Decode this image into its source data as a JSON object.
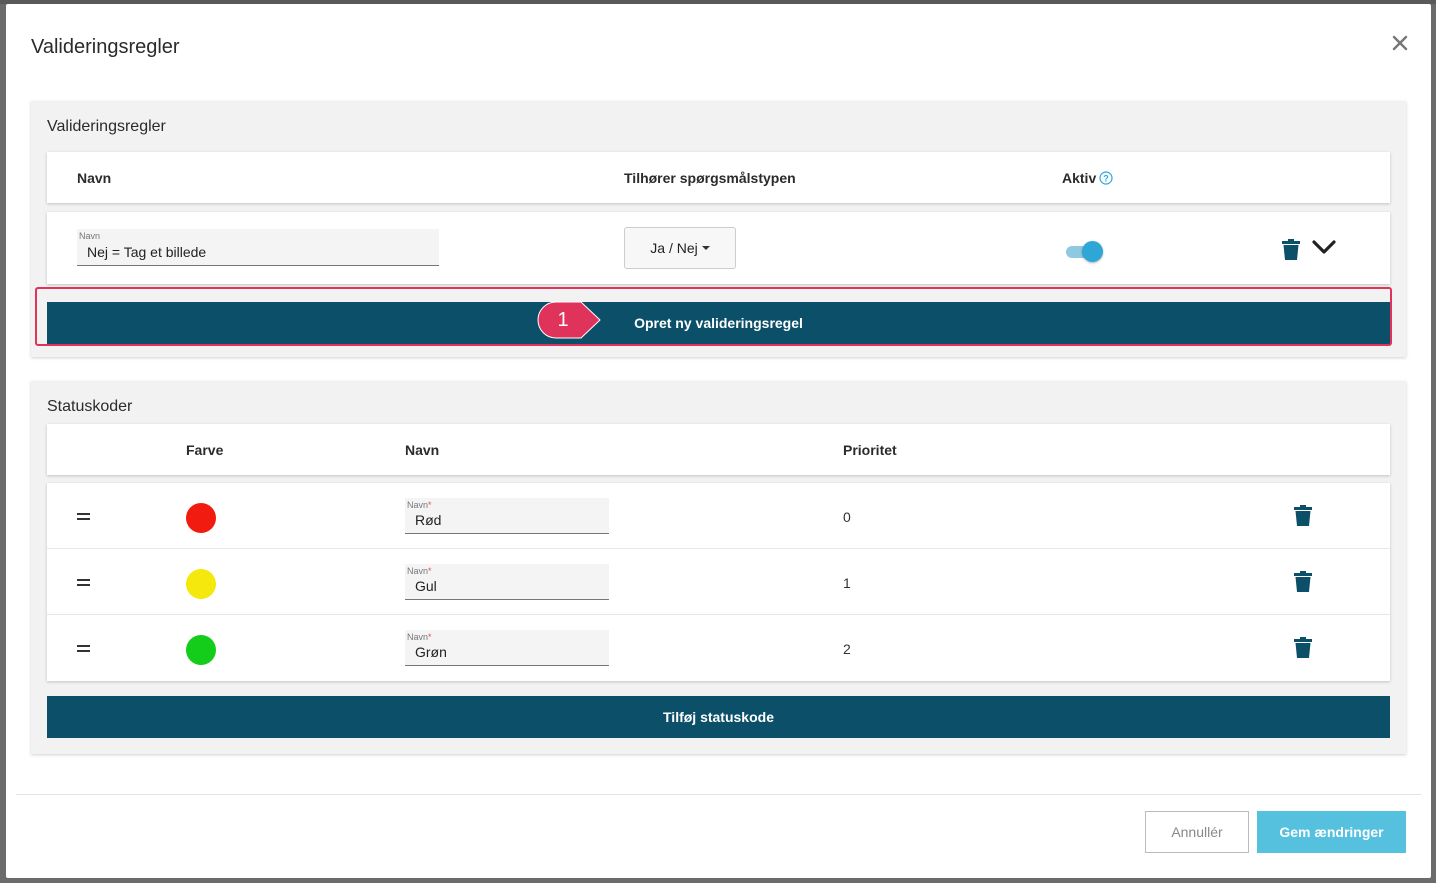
{
  "modal": {
    "title": "Valideringsregler",
    "close_icon": "close-icon"
  },
  "rules_panel": {
    "title": "Valideringsregler",
    "headers": {
      "name": "Navn",
      "question_type": "Tilhører spørgsmålstypen",
      "active": "Aktiv"
    },
    "rule": {
      "name_label": "Navn",
      "name_value": "Nej = Tag et billede",
      "question_type_value": "Ja / Nej",
      "active": true
    },
    "create_button": "Opret ny valideringsregel",
    "callout_number": "1"
  },
  "status_panel": {
    "title": "Statuskoder",
    "headers": {
      "color": "Farve",
      "name": "Navn",
      "priority": "Prioritet"
    },
    "field_label": "Navn",
    "field_required_mark": "*",
    "rows": [
      {
        "color": "#f21b0f",
        "name": "Rød",
        "priority": "0"
      },
      {
        "color": "#f4e80c",
        "name": "Gul",
        "priority": "1"
      },
      {
        "color": "#14cc1a",
        "name": "Grøn",
        "priority": "2"
      }
    ],
    "add_button": "Tilføj statuskode"
  },
  "footer": {
    "cancel": "Annullér",
    "save": "Gem ændringer"
  },
  "colors": {
    "primary": "#0b5068",
    "accent": "#56c0df",
    "highlight": "#e0335c"
  }
}
